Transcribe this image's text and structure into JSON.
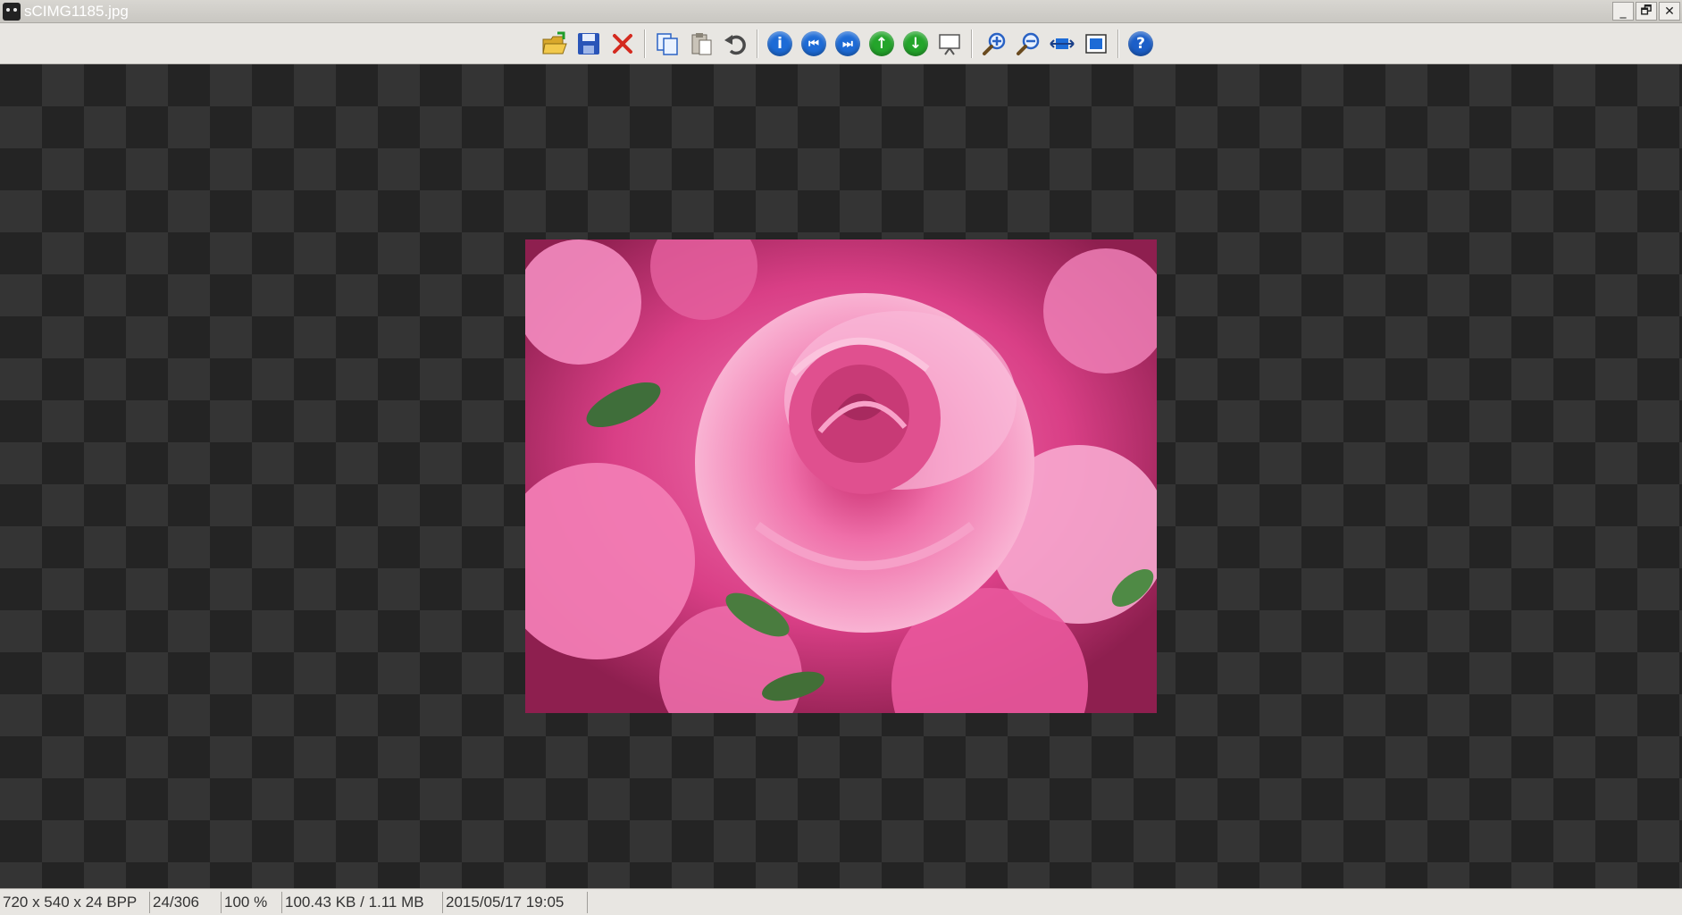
{
  "window": {
    "title": "sCIMG1185.jpg",
    "controls": {
      "minimize": "_",
      "restore": "🗗",
      "close": "✕"
    }
  },
  "toolbar": {
    "items": [
      {
        "name": "open-folder-icon"
      },
      {
        "name": "save-icon"
      },
      {
        "name": "delete-icon"
      },
      {
        "name": "copy-icon"
      },
      {
        "name": "paste-icon"
      },
      {
        "name": "undo-icon"
      },
      {
        "name": "info-icon",
        "glyph": "i"
      },
      {
        "name": "previous-image-icon",
        "glyph": "⏮"
      },
      {
        "name": "next-image-icon",
        "glyph": "⏭"
      },
      {
        "name": "up-arrow-icon",
        "glyph": "↑"
      },
      {
        "name": "down-arrow-icon",
        "glyph": "↓"
      },
      {
        "name": "slideshow-icon"
      },
      {
        "name": "zoom-in-icon"
      },
      {
        "name": "zoom-out-icon"
      },
      {
        "name": "fit-width-icon"
      },
      {
        "name": "fit-window-icon"
      },
      {
        "name": "help-icon",
        "glyph": "?"
      }
    ]
  },
  "viewer": {
    "image_subject": "pink rose"
  },
  "status": {
    "dimensions": "720 x 540 x 24 BPP",
    "index": "24/306",
    "zoom": "100 %",
    "filesize": "100.43 KB / 1.11 MB",
    "date": "2015/05/17 19:05"
  },
  "colors": {
    "checker_dark": "#242424",
    "checker_light": "#343434",
    "accent_blue": "#1d6bd6",
    "accent_green": "#24a52b"
  }
}
